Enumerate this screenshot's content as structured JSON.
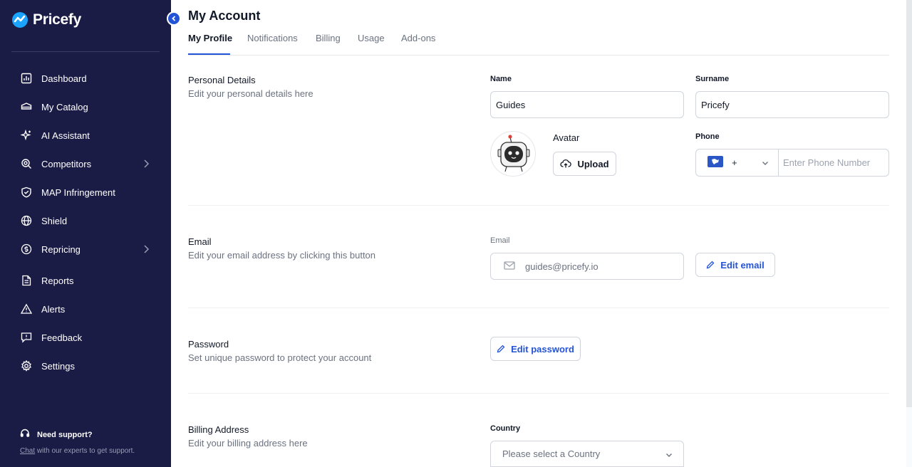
{
  "app": {
    "brand": "Pricefy",
    "accent_color": "#2454d6",
    "sidebar_color": "#1b1c46"
  },
  "sidebar": {
    "items": [
      {
        "label": "Dashboard",
        "icon": "chart-icon"
      },
      {
        "label": "My Catalog",
        "icon": "catalog-icon"
      },
      {
        "label": "AI Assistant",
        "icon": "sparkle-icon"
      },
      {
        "label": "Competitors",
        "icon": "search-competitor-icon",
        "expandable": true
      },
      {
        "label": "MAP Infringement",
        "icon": "shield-check-icon"
      },
      {
        "label": "Shield",
        "icon": "globe-icon"
      },
      {
        "label": "Repricing",
        "icon": "repricing-icon",
        "expandable": true
      },
      {
        "label": "Reports",
        "icon": "report-icon"
      },
      {
        "label": "Alerts",
        "icon": "alert-icon"
      },
      {
        "label": "Feedback",
        "icon": "feedback-icon"
      },
      {
        "label": "Settings",
        "icon": "gear-icon"
      }
    ],
    "support": {
      "title": "Need support?",
      "link": "Chat",
      "text": " with our experts to get support."
    }
  },
  "page": {
    "title": "My Account",
    "tabs": [
      "My Profile",
      "Notifications",
      "Billing",
      "Usage",
      "Add-ons"
    ],
    "active_tab": "My Profile"
  },
  "personal": {
    "title": "Personal Details",
    "subtitle": "Edit your personal details here",
    "name_label": "Name",
    "name_value": "Guides",
    "surname_label": "Surname",
    "surname_value": "Pricefy",
    "avatar_label": "Avatar",
    "upload_label": "Upload",
    "phone_label": "Phone",
    "phone_prefix": "+",
    "phone_placeholder": "Enter Phone Number"
  },
  "email": {
    "title": "Email",
    "subtitle": "Edit your email address by clicking this button",
    "label": "Email",
    "value": "guides@pricefy.io",
    "edit_label": "Edit email"
  },
  "password": {
    "title": "Password",
    "subtitle": "Set unique password to protect your account",
    "edit_label": "Edit password"
  },
  "billing": {
    "title": "Billing Address",
    "subtitle": "Edit your billing address here",
    "country_label": "Country",
    "country_placeholder": "Please select a Country"
  }
}
